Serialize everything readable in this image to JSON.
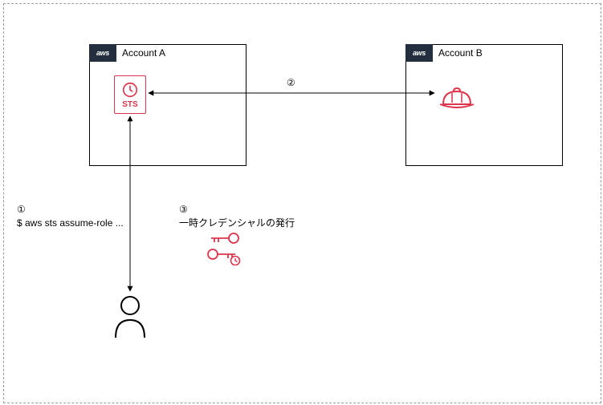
{
  "accountA": {
    "label": "Account A"
  },
  "accountB": {
    "label": "Account B"
  },
  "sts": {
    "label": "STS"
  },
  "aws": {
    "label": "aws"
  },
  "step1": {
    "num": "①",
    "cmd": "$ aws sts assume-role ..."
  },
  "step2": {
    "num": "②"
  },
  "step3": {
    "num": "③",
    "text": "一時クレデンシャルの発行"
  }
}
